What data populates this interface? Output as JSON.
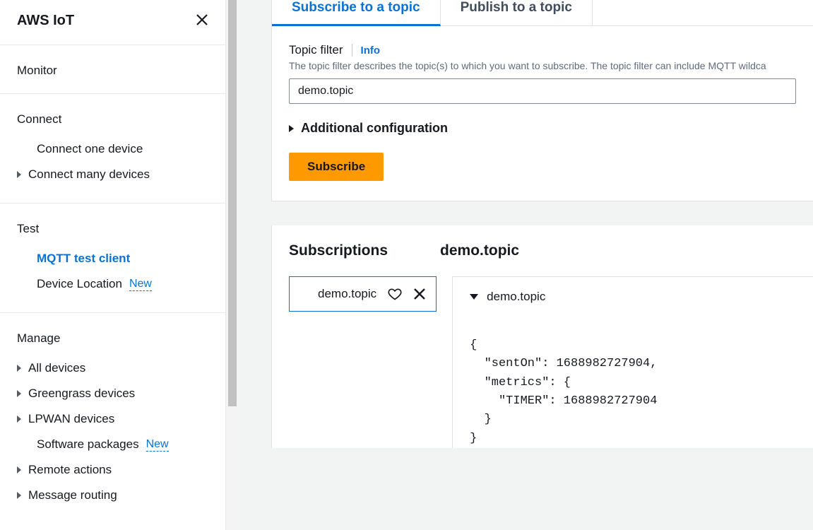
{
  "sidebar": {
    "title": "AWS IoT",
    "groups": [
      {
        "heading": "Monitor",
        "items": []
      },
      {
        "heading": "Connect",
        "items": [
          {
            "label": "Connect one device",
            "expandable": false
          },
          {
            "label": "Connect many devices",
            "expandable": true
          }
        ]
      },
      {
        "heading": "Test",
        "items": [
          {
            "label": "MQTT test client",
            "active": true
          },
          {
            "label": "Device Location",
            "badge": "New"
          }
        ]
      },
      {
        "heading": "Manage",
        "items": [
          {
            "label": "All devices",
            "expandable": true
          },
          {
            "label": "Greengrass devices",
            "expandable": true
          },
          {
            "label": "LPWAN devices",
            "expandable": true
          },
          {
            "label": "Software packages",
            "expandable": false,
            "badge": "New"
          },
          {
            "label": "Remote actions",
            "expandable": true
          },
          {
            "label": "Message routing",
            "expandable": true
          }
        ]
      }
    ]
  },
  "tabs": {
    "subscribe": "Subscribe to a topic",
    "publish": "Publish to a topic"
  },
  "topicFilter": {
    "label": "Topic filter",
    "info": "Info",
    "help": "The topic filter describes the topic(s) to which you want to subscribe. The topic filter can include MQTT wildca",
    "value": "demo.topic"
  },
  "additionalConfig": "Additional configuration",
  "subscribeButton": "Subscribe",
  "subscriptions": {
    "title": "Subscriptions",
    "currentTopic": "demo.topic",
    "chip": {
      "label": "demo.topic"
    },
    "message": {
      "topic": "demo.topic",
      "body": "{\n  \"sentOn\": 1688982727904,\n  \"metrics\": {\n    \"TIMER\": 1688982727904\n  }\n}"
    }
  }
}
